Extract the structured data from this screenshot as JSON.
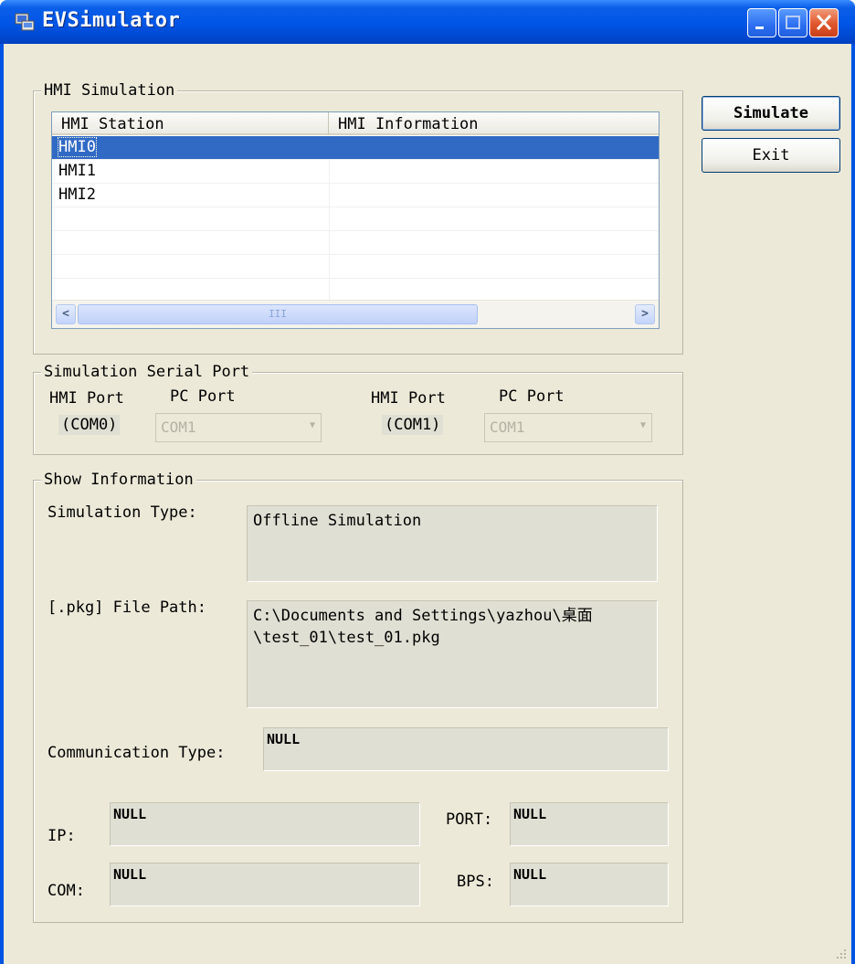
{
  "window": {
    "title": "EVSimulator"
  },
  "hmi_simulation": {
    "legend": "HMI Simulation",
    "columns": [
      "HMI Station",
      "HMI Information"
    ],
    "rows": [
      {
        "station": "HMI0",
        "info": ""
      },
      {
        "station": "HMI1",
        "info": ""
      },
      {
        "station": "HMI2",
        "info": ""
      }
    ],
    "scroll_thumb_grip": "III",
    "selected_row": 0
  },
  "buttons": {
    "simulate": "Simulate",
    "exit": "Exit"
  },
  "serial_port": {
    "legend": "Simulation Serial Port",
    "hmi_port_label": "HMI Port",
    "pc_port_label": "PC Port",
    "port0": {
      "hmi": "(COM0)",
      "pc": "COM1"
    },
    "port1": {
      "hmi": "(COM1)",
      "pc": "COM1"
    }
  },
  "show_info": {
    "legend": "Show Information",
    "sim_type_label": "Simulation Type:",
    "sim_type_value": "Offline Simulation",
    "file_path_label": "[.pkg] File Path:",
    "file_path_value": "C:\\Documents and Settings\\yazhou\\桌面\n\\test_01\\test_01.pkg",
    "comm_type_label": "Communication Type:",
    "comm_type_value": "NULL",
    "ip_label": "IP:",
    "ip_value": "NULL",
    "port_label": "PORT:",
    "port_value": "NULL",
    "com_label": "COM:",
    "com_value": "NULL",
    "bps_label": "BPS:",
    "bps_value": "NULL"
  },
  "colors": {
    "titlebar": "#0054e3",
    "dialog": "#ece9d8",
    "selection": "#316ac5",
    "readonly_box": "#e0dfd3"
  }
}
